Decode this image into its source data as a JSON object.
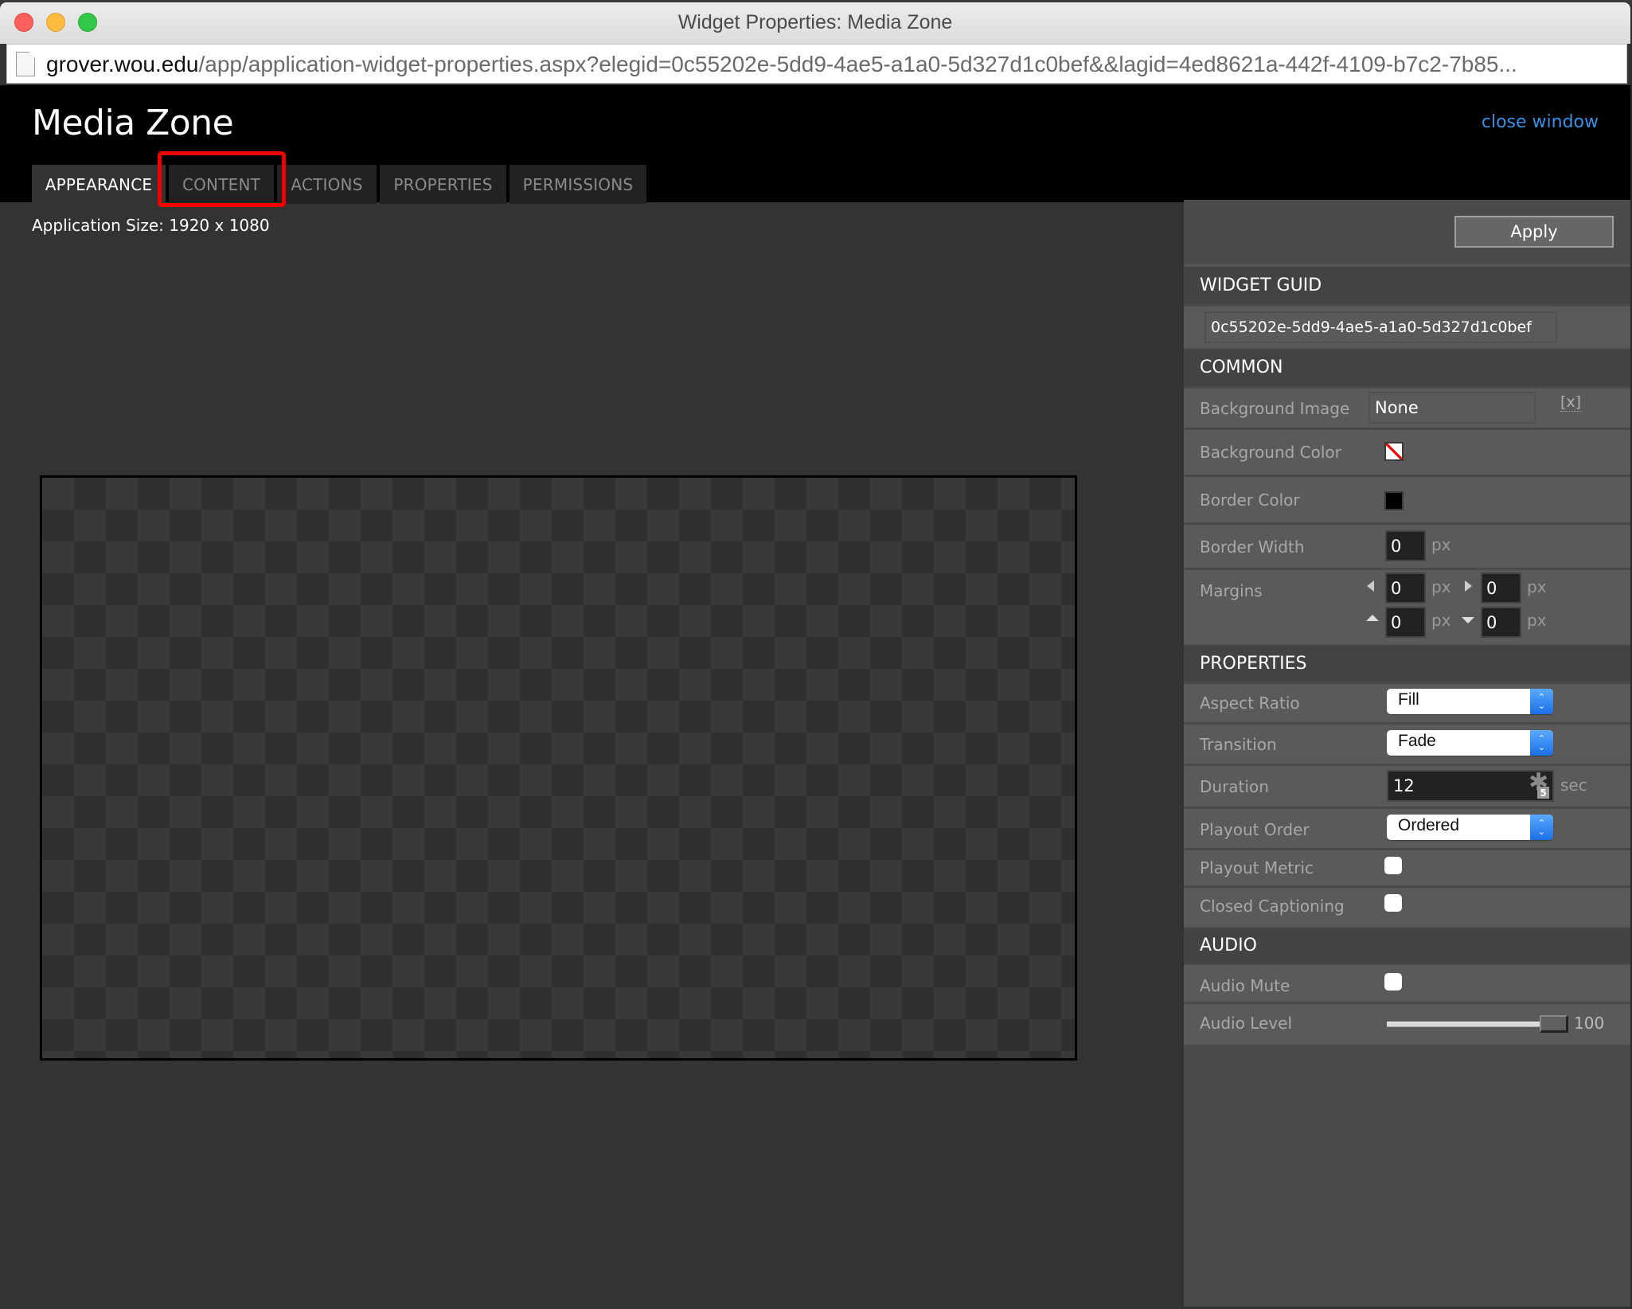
{
  "window": {
    "title": "Widget Properties: Media Zone",
    "url_host": "grover.wou.edu",
    "url_path": "/app/application-widget-properties.aspx?elegid=0c55202e-5dd9-4ae5-a1a0-5d327d1c0bef&&lagid=4ed8621a-442f-4109-b7c2-7b85..."
  },
  "header": {
    "title": "Media Zone",
    "close_label": "close window",
    "tabs": [
      {
        "label": "APPEARANCE",
        "active": true
      },
      {
        "label": "CONTENT",
        "active": false,
        "highlighted": true
      },
      {
        "label": "ACTIONS",
        "active": false
      },
      {
        "label": "PROPERTIES",
        "active": false
      },
      {
        "label": "PERMISSIONS",
        "active": false
      }
    ]
  },
  "main": {
    "app_size": "Application Size: 1920 x 1080"
  },
  "panel": {
    "apply_label": "Apply",
    "sections": {
      "guid": "WIDGET GUID",
      "common": "COMMON",
      "properties": "PROPERTIES",
      "audio": "AUDIO"
    },
    "widget_guid": "0c55202e-5dd9-4ae5-a1a0-5d327d1c0bef",
    "common": {
      "background_image": {
        "label": "Background Image",
        "value": "None",
        "clear": "[x]"
      },
      "background_color": {
        "label": "Background Color",
        "value": "none"
      },
      "border_color": {
        "label": "Border Color",
        "value": "#000000"
      },
      "border_width": {
        "label": "Border Width",
        "value": "0",
        "unit": "px"
      },
      "margins": {
        "label": "Margins",
        "left": "0",
        "right": "0",
        "top": "0",
        "bottom": "0",
        "unit": "px"
      }
    },
    "properties": {
      "aspect_ratio": {
        "label": "Aspect Ratio",
        "value": "Fill"
      },
      "transition": {
        "label": "Transition",
        "value": "Fade"
      },
      "duration": {
        "label": "Duration",
        "value": "12",
        "unit": "sec",
        "badge": "5"
      },
      "playout_order": {
        "label": "Playout Order",
        "value": "Ordered"
      },
      "playout_metric": {
        "label": "Playout Metric",
        "checked": false
      },
      "closed_captioning": {
        "label": "Closed Captioning",
        "checked": false
      }
    },
    "audio": {
      "mute": {
        "label": "Audio Mute",
        "checked": false
      },
      "level": {
        "label": "Audio Level",
        "value": "100",
        "fraction": 1.0
      }
    }
  },
  "colors": {
    "accent_link": "#3a8ee6",
    "highlight": "#f20000",
    "select_stepper": "#1b6fe6"
  }
}
